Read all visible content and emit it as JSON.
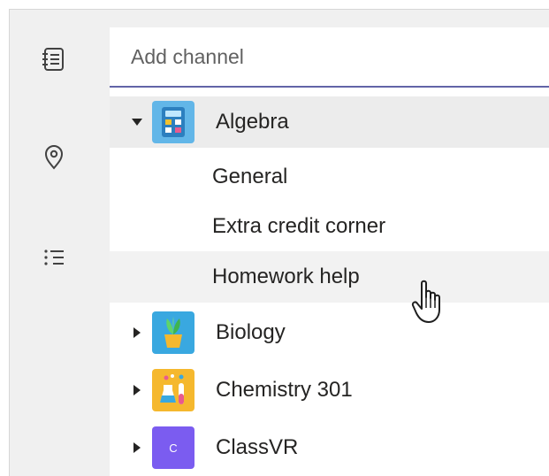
{
  "app_rail": {
    "items": [
      {
        "icon": "notes-icon"
      },
      {
        "icon": "location-pin-icon"
      },
      {
        "icon": "list-icon"
      }
    ]
  },
  "channel_panel": {
    "add_channel_placeholder": "Add channel",
    "teams": [
      {
        "name": "Algebra",
        "expanded": true,
        "icon": "calculator-icon",
        "icon_color": "#62b6e8",
        "channels": [
          "General",
          "Extra credit corner",
          "Homework help"
        ]
      },
      {
        "name": "Biology",
        "expanded": false,
        "icon": "plant-icon",
        "icon_color": "#39a8e0"
      },
      {
        "name": "Chemistry 301",
        "expanded": false,
        "icon": "flask-icon",
        "icon_color": "#f5b82e"
      },
      {
        "name": "ClassVR",
        "expanded": false,
        "icon": "letter-c-icon",
        "icon_text": "C",
        "icon_color": "#7b5cf0"
      }
    ],
    "hovered_channel": "Homework help"
  },
  "colors": {
    "accent": "#6264a7",
    "selected_row": "#ececec",
    "hover_row": "#f2f2f2",
    "rail_background": "#f0f0f0"
  }
}
